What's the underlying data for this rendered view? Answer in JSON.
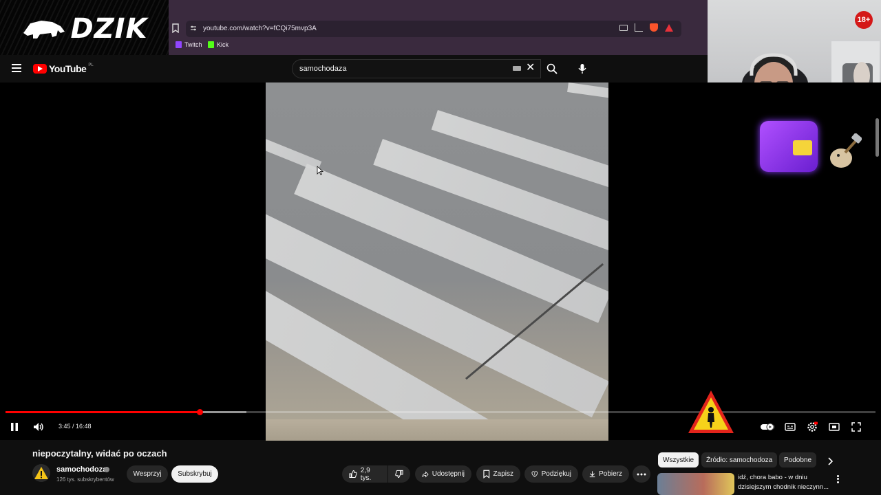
{
  "overlay": {
    "logo_text": "DZIK",
    "age_badge": "18+"
  },
  "browser": {
    "url": "youtube.com/watch?v=fCQi75mvp3A",
    "bookmarks": [
      {
        "label": "Twitch",
        "icon": "twitch-icon",
        "color": "#9146ff"
      },
      {
        "label": "Kick",
        "icon": "kick-icon",
        "color": "#53fc18"
      }
    ]
  },
  "youtube": {
    "logo_text": "YouTube",
    "region": "PL",
    "search": {
      "value": "samochodaza"
    }
  },
  "player": {
    "time_current": "3:45",
    "time_total": "16:48",
    "progress": 0.223,
    "buffered": 0.277,
    "time_display": "3:45 / 16:48"
  },
  "video": {
    "title": "niepoczytalny, widać po oczach",
    "channel": "samochodoza",
    "subscribers": "126 tys. subskrybentów",
    "support_label": "Wesprzyj",
    "subscribe_label": "Subskrybuj",
    "likes": "2,9 tys.",
    "share_label": "Udostępnij",
    "save_label": "Zapisz",
    "thanks_label": "Podziękuj",
    "download_label": "Pobierz"
  },
  "recommendations": {
    "chips": [
      "Wszystkie",
      "Źródło: samochodoza",
      "Podobne"
    ],
    "first_title": "idź, chora babo - w dniu dzisiejszym chodnik nieczynn..."
  },
  "colors": {
    "brand_red": "#ff0000",
    "browser_bg": "#3a2a3e",
    "page_bg": "#0f0f0f"
  }
}
